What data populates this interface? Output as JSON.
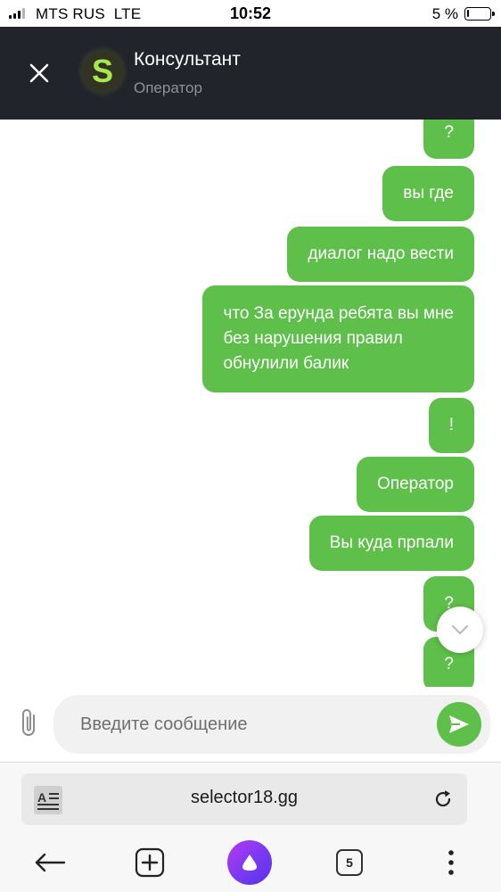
{
  "status_bar": {
    "carrier": "MTS RUS  LTE",
    "time": "10:52",
    "battery_percent_label": "5 %",
    "battery_level": 0.05
  },
  "header": {
    "avatar_letter": "S",
    "title": "Консультант",
    "subtitle": "Оператор",
    "accent_color": "#a8e84a"
  },
  "messages": [
    {
      "text": "?"
    },
    {
      "text": "вы где"
    },
    {
      "text": "диалог надо вести"
    },
    {
      "text": "что За ерунда ребята вы мне\nбез нарушения правил\nобнулили балик"
    },
    {
      "text": "!"
    },
    {
      "text": "Оператор"
    },
    {
      "text": "Вы куда прпали"
    },
    {
      "text": "?"
    },
    {
      "text": "?"
    }
  ],
  "composer": {
    "placeholder": "Введите сообщение",
    "send_color": "#5ec04a"
  },
  "browser": {
    "url": "selector18.gg",
    "tabs_count": "5"
  },
  "icons": [
    "close-icon",
    "scroll-down-icon",
    "paperclip-icon",
    "send-icon",
    "reader-icon",
    "reload-icon",
    "back-arrow-icon",
    "new-tab-icon",
    "alice-icon",
    "more-icon"
  ]
}
